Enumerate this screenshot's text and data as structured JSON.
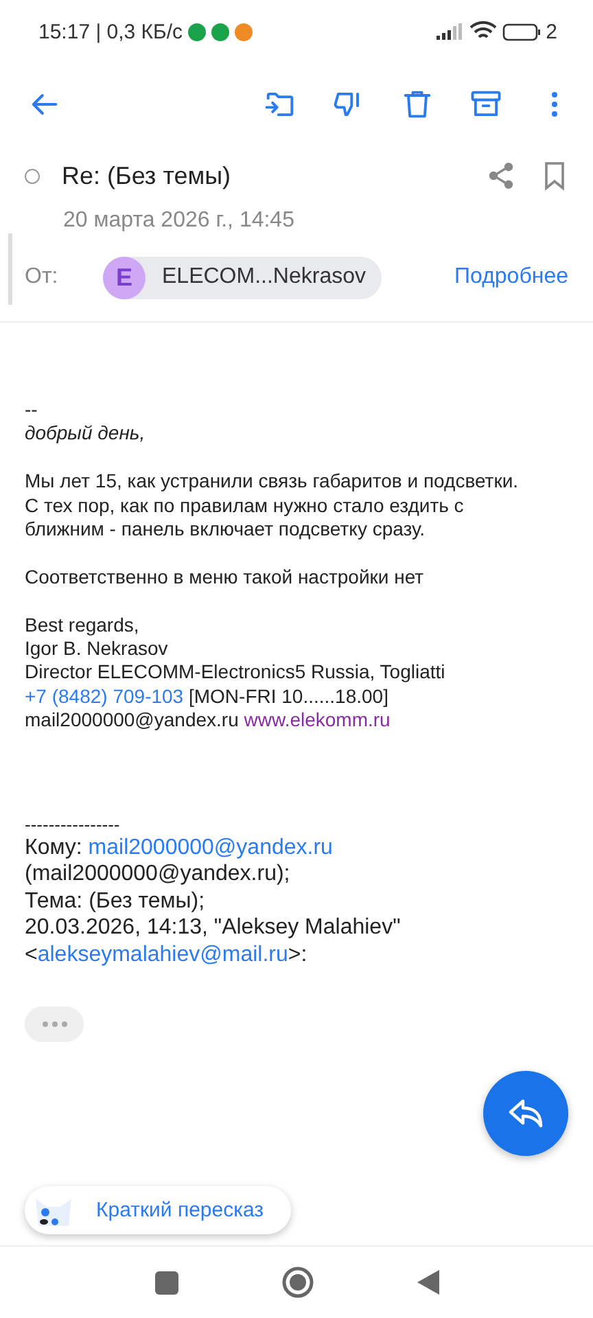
{
  "status_bar": {
    "time": "15:17 | 0,3 КБ/с",
    "battery": "2"
  },
  "subject": {
    "text": "Re: (Без темы)",
    "read": true
  },
  "date": "20 марта 2026 г., 14:45",
  "from": {
    "label": "От:",
    "initial": "E",
    "name": "ELECOM...Nekrasov",
    "details": "Подробнее"
  },
  "body": [
    [
      {
        "kind": "plain",
        "parts": [
          {
            "kind": "text",
            "text": "--"
          }
        ]
      },
      {
        "kind": "italic",
        "parts": [
          {
            "kind": "text",
            "text": "добрый день,"
          }
        ]
      }
    ],
    [
      {
        "kind": "plain",
        "parts": [
          {
            "kind": "text",
            "text": "Мы лет 15, как устранили связь габаритов и подсветки."
          }
        ]
      },
      {
        "kind": "plain",
        "parts": [
          {
            "kind": "text",
            "text": "С тех пор, как по правилам нужно стало ездить с"
          }
        ]
      },
      {
        "kind": "plain",
        "parts": [
          {
            "kind": "text",
            "text": "ближним -  панель включает подсветку сразу."
          }
        ]
      }
    ],
    [
      {
        "kind": "plain",
        "parts": [
          {
            "kind": "text",
            "text": "Соответственно в меню такой настройки нет"
          }
        ]
      }
    ],
    [
      {
        "kind": "plain",
        "parts": [
          {
            "kind": "text",
            "text": "Best regards,"
          }
        ]
      },
      {
        "kind": "plain",
        "parts": [
          {
            "kind": "text",
            "text": "Igor B. Nekrasov"
          }
        ]
      },
      {
        "kind": "plain",
        "parts": [
          {
            "kind": "text",
            "text": "Director ELECOMM-Electronics5 Russia, Togliatti"
          }
        ]
      },
      {
        "kind": "plain",
        "parts": [
          {
            "kind": "link",
            "text": "+7 (8482) 709-103"
          },
          {
            "kind": "text",
            "text": " [MON-FRI 10......18.00]"
          }
        ]
      },
      {
        "kind": "plain",
        "parts": [
          {
            "kind": "text",
            "text": "mail2000000@yandex.ru "
          },
          {
            "kind": "visited",
            "text": "www.elekomm.ru"
          }
        ]
      }
    ]
  ],
  "quote": [
    {
      "kind": "plain",
      "parts": [
        {
          "kind": "text",
          "text": "----------------"
        }
      ]
    },
    {
      "kind": "large",
      "parts": [
        {
          "kind": "text",
          "text": "Кому: "
        },
        {
          "kind": "link",
          "text": "mail2000000@yandex.ru"
        }
      ]
    },
    {
      "kind": "large",
      "parts": [
        {
          "kind": "text",
          "text": "(mail2000000@yandex.ru);"
        }
      ]
    },
    {
      "kind": "large",
      "parts": [
        {
          "kind": "text",
          "text": "Тема: (Без темы);"
        }
      ]
    },
    {
      "kind": "large",
      "parts": [
        {
          "kind": "text",
          "text": "20.03.2026, 14:13, \"Aleksey Malahiev\""
        }
      ]
    },
    {
      "kind": "large",
      "parts": [
        {
          "kind": "text",
          "text": "<"
        },
        {
          "kind": "link",
          "text": "alekseymalahiev@mail.ru"
        },
        {
          "kind": "text",
          "text": ">:"
        }
      ]
    }
  ],
  "summary_button": "Краткий пересказ"
}
